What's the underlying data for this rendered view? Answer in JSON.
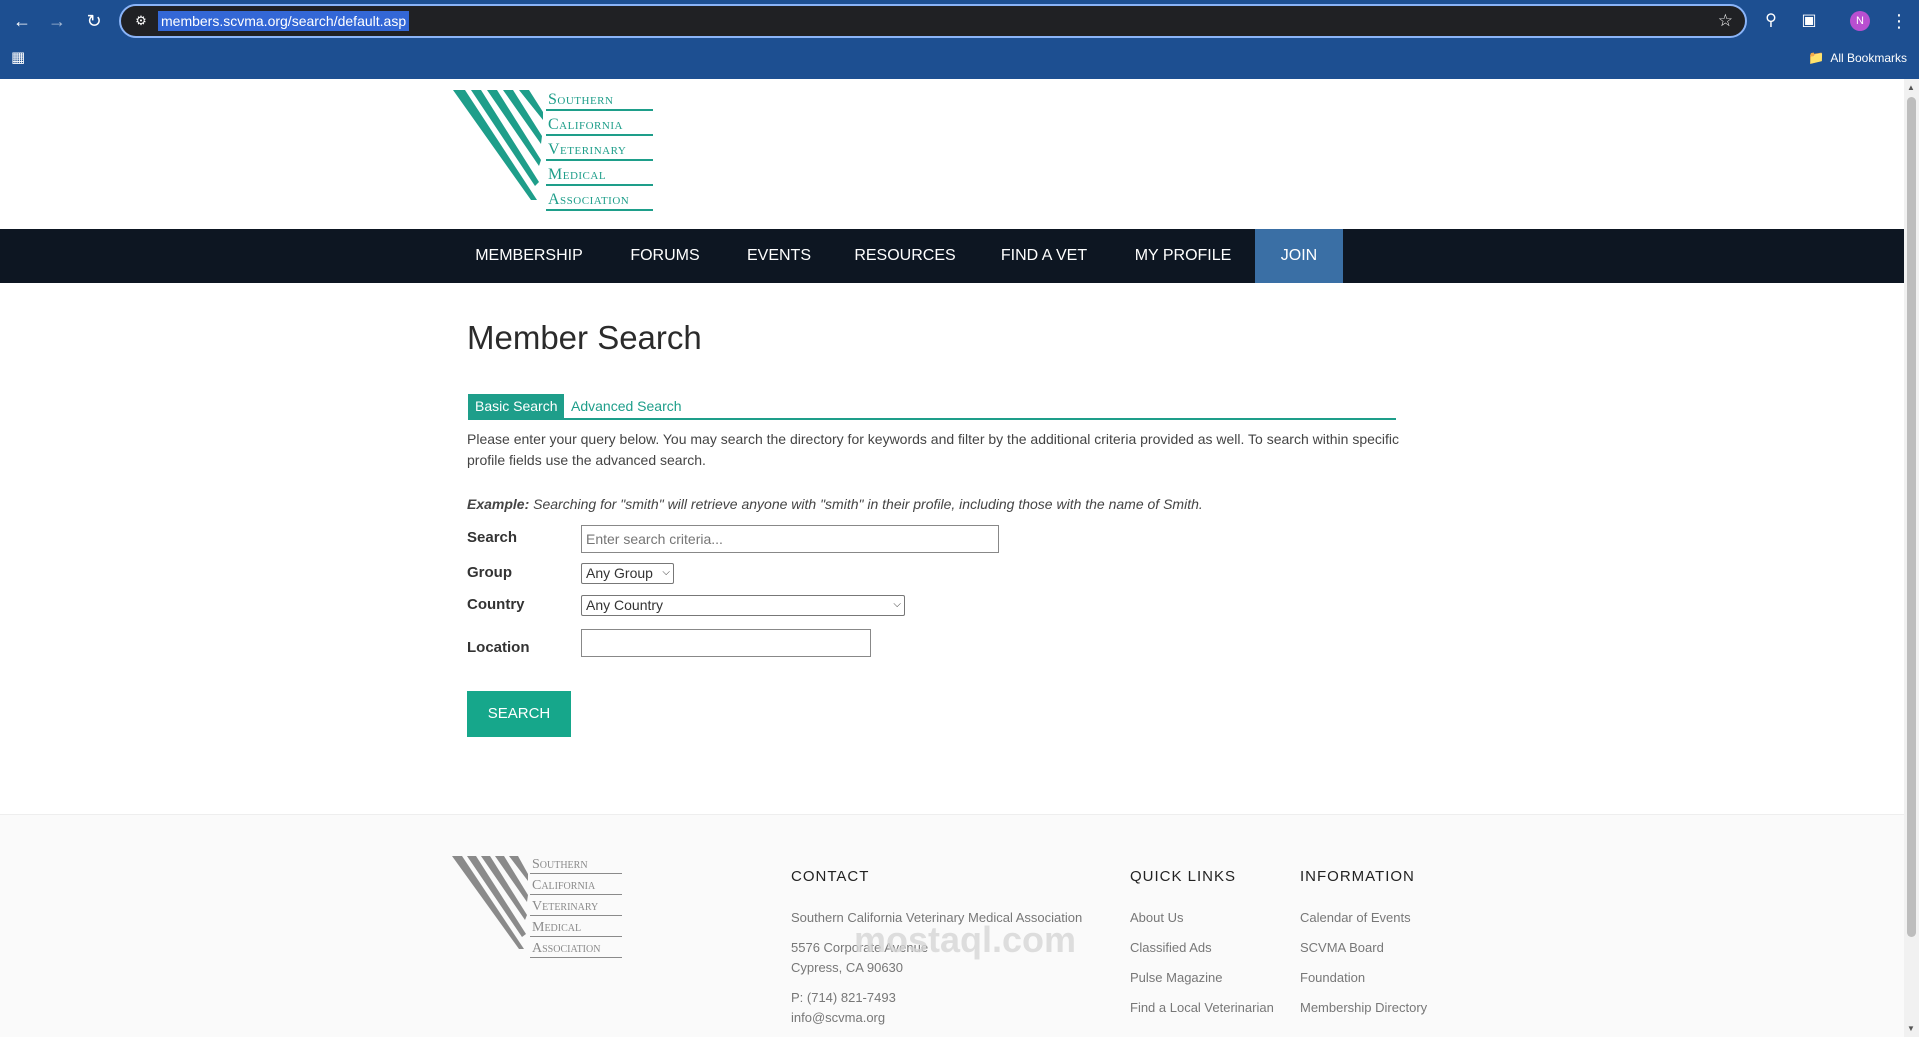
{
  "browser": {
    "url": "members.scvma.org/search/default.asp",
    "bookmarks_label": "All Bookmarks",
    "profile_initial": "N",
    "icons": [
      "back-icon",
      "forward-icon",
      "reload-icon",
      "site-info-icon",
      "star-icon",
      "search-lens-icon",
      "extensions-icon",
      "menu-icon",
      "apps-icon",
      "folder-icon"
    ]
  },
  "logo": {
    "lines": [
      "Southern",
      "California",
      "Veterinary",
      "Medical",
      "Association"
    ]
  },
  "nav": {
    "items": [
      "MEMBERSHIP",
      "FORUMS",
      "EVENTS",
      "RESOURCES",
      "FIND A VET",
      "MY PROFILE",
      "JOIN"
    ]
  },
  "main": {
    "title": "Member Search",
    "tabs": [
      "Basic Search",
      "Advanced Search"
    ],
    "intro": "Please enter your query below. You may search the directory for keywords and filter by the additional criteria provided as well. To search within specific profile fields use the advanced search.",
    "example_label": "Example:",
    "example_text": " Searching for \"smith\" will retrieve anyone with \"smith\" in their profile, including those with the name of Smith.",
    "fields": {
      "search_label": "Search",
      "search_placeholder": "Enter search criteria...",
      "group_label": "Group",
      "group_value": "Any Group",
      "country_label": "Country",
      "country_value": "Any Country",
      "location_label": "Location",
      "location_value": ""
    },
    "search_button": "SEARCH"
  },
  "footer": {
    "contact": {
      "title": "CONTACT",
      "org": "Southern California Veterinary Medical Association",
      "address1": "5576 Corporate Avenue",
      "address2": "Cypress, CA 90630",
      "phone": "P: (714) 821-7493",
      "email": "info@scvma.org"
    },
    "quick_links": {
      "title": "QUICK LINKS",
      "items": [
        "About Us",
        "Classified Ads",
        "Pulse Magazine",
        "Find a Local Veterinarian"
      ]
    },
    "information": {
      "title": "INFORMATION",
      "items": [
        "Calendar of Events",
        "SCVMA Board",
        "Foundation",
        "Membership Directory"
      ]
    },
    "watermark": "mostaql.com"
  },
  "colors": {
    "browser_bar": "#1d4f91",
    "brand_teal": "#1e9e8a",
    "nav_bg": "#0d1622",
    "join_bg": "#3a6fa5",
    "button_bg": "#16a78b"
  }
}
